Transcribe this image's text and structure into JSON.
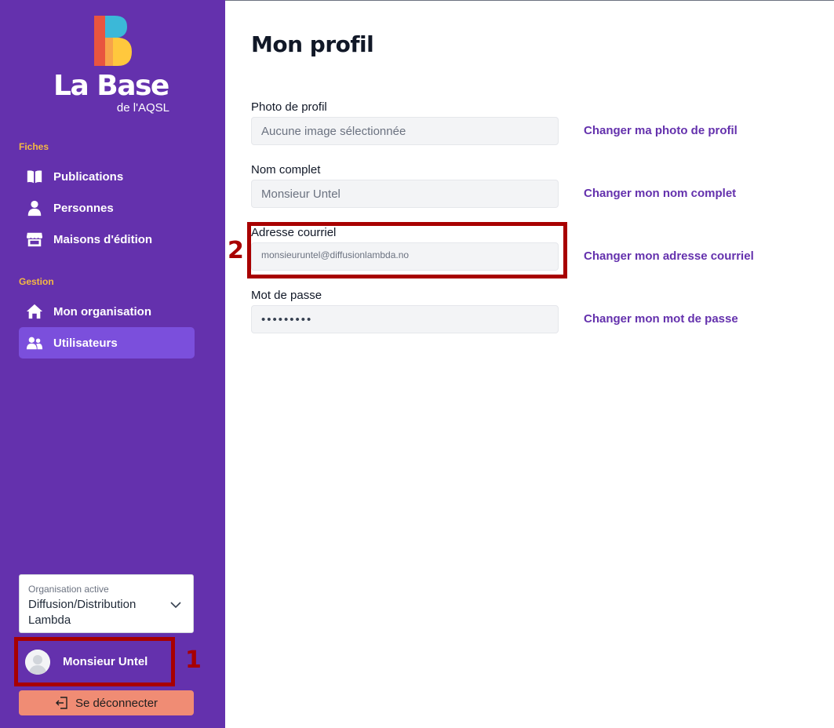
{
  "brand": {
    "title": "La Base",
    "subtitle": "de l'AQSL",
    "colors": {
      "sidebar": "#6431ad",
      "active": "#7b4fdc",
      "accent": "#f5b942",
      "link": "#6431ad",
      "logout": "#f08c74",
      "highlight": "#a80000"
    }
  },
  "sidebar": {
    "sections": [
      {
        "label": "Fiches",
        "items": [
          {
            "label": "Publications",
            "icon": "book-icon"
          },
          {
            "label": "Personnes",
            "icon": "person-icon"
          },
          {
            "label": "Maisons d'édition",
            "icon": "store-icon"
          }
        ]
      },
      {
        "label": "Gestion",
        "items": [
          {
            "label": "Mon organisation",
            "icon": "home-icon"
          },
          {
            "label": "Utilisateurs",
            "icon": "users-icon",
            "active": true
          }
        ]
      }
    ],
    "organization": {
      "caption": "Organisation active",
      "name": "Diffusion/Distribution Lambda"
    },
    "user": {
      "name": "Monsieur Untel"
    },
    "logout_label": "Se déconnecter"
  },
  "markers": {
    "one": "1",
    "two": "2"
  },
  "main": {
    "title": "Mon profil",
    "fields": [
      {
        "label": "Photo de profil",
        "value": "Aucune image sélectionnée",
        "link": "Changer ma photo de profil"
      },
      {
        "label": "Nom complet",
        "value": "Monsieur Untel",
        "link": "Changer mon nom complet"
      },
      {
        "label": "Adresse courriel",
        "value": "monsieuruntel@diffusionlambda.no",
        "link": "Changer mon adresse courriel"
      },
      {
        "label": "Mot de passe",
        "value": "•••••••••",
        "link": "Changer mon mot de passe"
      }
    ]
  }
}
